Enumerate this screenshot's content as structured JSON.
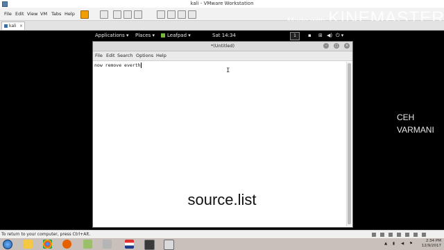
{
  "vm": {
    "title": "kali - VMware Workstation",
    "menu": [
      "File",
      "Edit",
      "View",
      "VM",
      "Tabs",
      "Help"
    ],
    "tab_label": "kali",
    "status_text": "To return to your computer, press Ctrl+Alt."
  },
  "watermark": {
    "prefix": "Made with",
    "brand": "KINEMASTER"
  },
  "kali_panel": {
    "applications": "Applications ▾",
    "places": "Places ▾",
    "leafpad": "Leafpad ▾",
    "clock": "Sat 14:34",
    "workspace": "1"
  },
  "leafpad": {
    "title": "*(Untitled)",
    "menu": [
      "File",
      "Edit",
      "Search",
      "Options",
      "Help"
    ],
    "content": "now remove everth"
  },
  "overlay": {
    "caption": "source.list",
    "channel_line1": "CEH",
    "channel_line2": "VARMANI"
  },
  "taskbar": {
    "time": "2:34 PM",
    "date": "12/9/2017",
    "apps": [
      "file-explorer-icon",
      "chrome-icon",
      "firefox-icon",
      "notepad-icon",
      "app-icon",
      "flag-icon",
      "vmware-icon",
      "terminal-icon",
      "storage-icon"
    ]
  },
  "colors": {
    "leafpad_icon": "#74b640",
    "pause_button": "#f0a000",
    "taskbar_bg": "#c9c0bb"
  }
}
